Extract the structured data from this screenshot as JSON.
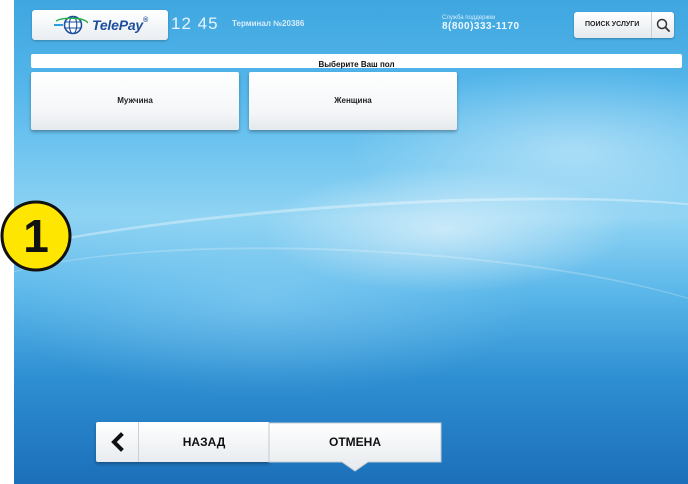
{
  "header": {
    "logo_text": "TelePay",
    "time": "12 45",
    "terminal": "Терминал №20386",
    "support_label": "Служба поддержки",
    "support_phone": "8(800)333-1170",
    "search_label": "ПОИСК УСЛУГИ",
    "search_icon": "search-icon"
  },
  "page": {
    "title": "Выберите Ваш пол"
  },
  "options": [
    {
      "label": "Мужчина"
    },
    {
      "label": "Женщина"
    }
  ],
  "step_badge": "1",
  "footer": {
    "back_label": "НАЗАД",
    "cancel_label": "ОТМЕНА"
  },
  "colors": {
    "accent": "#1d4f9c",
    "badge_fill": "#ffe600",
    "background_top": "#3fa6e0",
    "background_bottom": "#1c6fba"
  }
}
